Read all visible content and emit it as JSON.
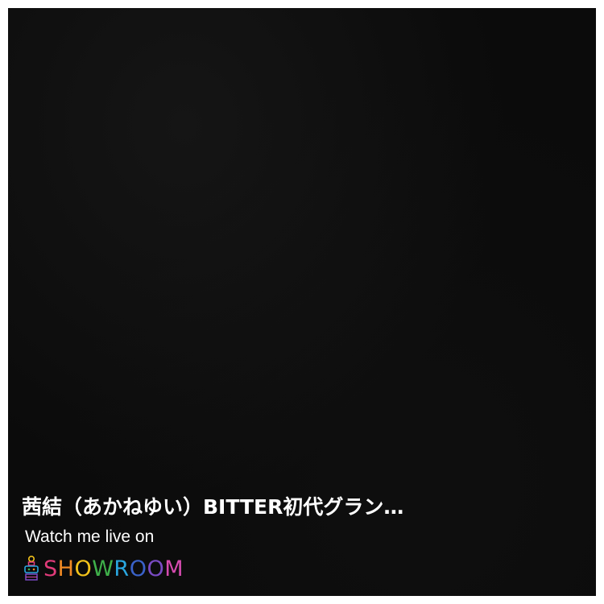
{
  "video": {
    "title": "茜結（あかねゆい）BITTER初代グラン…",
    "cta": "Watch me live on",
    "brand": {
      "name": "SHOWROOM",
      "letters": [
        "S",
        "H",
        "O",
        "W",
        "R",
        "O",
        "O",
        "M"
      ],
      "colors": [
        "#e23b7a",
        "#f08a24",
        "#f2c21b",
        "#3fb04a",
        "#2aa7e0",
        "#3a62c9",
        "#7a4bc4",
        "#d64bb0"
      ],
      "icon": "showroom-logo-icon"
    }
  }
}
